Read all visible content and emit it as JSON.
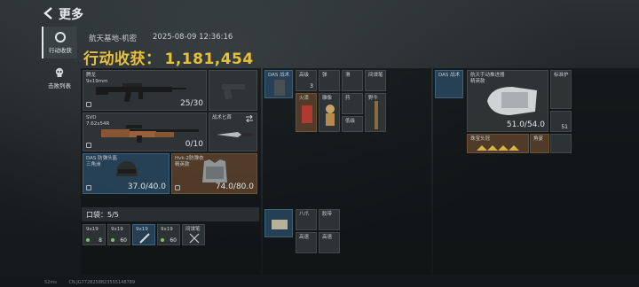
{
  "topbar": {
    "title": "更多"
  },
  "sidebar": {
    "tabs": [
      {
        "label": "行动收获",
        "icon": "target-icon"
      },
      {
        "label": "击败列表",
        "icon": "skull-icon"
      }
    ]
  },
  "info": {
    "location": "航天基地-机密",
    "timestamp": "2025-08-09 12:36:16",
    "value_label": "行动收获：",
    "value": "1,181,454"
  },
  "equipment": {
    "primary_weapon": {
      "name": "腾龙",
      "sub": "9x19mm",
      "count": "25/30"
    },
    "sidearm": {
      "name": ""
    },
    "sniper": {
      "name": "SVD",
      "sub": "7.62x54R",
      "count": "0/10"
    },
    "knife": {
      "name": "战术匕首"
    },
    "helmet": {
      "name": "DAS 防弹头盔",
      "sub": "三角洲",
      "count": "37.0/40.0"
    },
    "armor": {
      "name": "Hvk-2防弹衣",
      "sub": "精英款",
      "count": "74.0/80.0"
    }
  },
  "pockets": {
    "label": "口袋：",
    "value": "5/5",
    "items": [
      {
        "name": "9x19",
        "qty": "8"
      },
      {
        "name": "9x19",
        "qty": "60"
      },
      {
        "name": "9x19",
        "qty": ""
      },
      {
        "name": "9x19",
        "qty": "60"
      },
      {
        "name": "间谍笔",
        "qty": ""
      }
    ]
  },
  "rig": {
    "items": [
      {
        "name": "DAS 战术",
        "qty": ""
      },
      {
        "name": "高级",
        "qty": "3"
      },
      {
        "name": "弹",
        "qty": ""
      },
      {
        "name": "滑",
        "qty": ""
      },
      {
        "name": "间谍笔",
        "qty": ""
      },
      {
        "name": "火漆",
        "qty": ""
      },
      {
        "name": "雕像",
        "qty": ""
      },
      {
        "name": "药",
        "qty": ""
      },
      {
        "name": "",
        "qty": ""
      },
      {
        "name": "低级",
        "qty": ""
      },
      {
        "name": "野牛",
        "qty": ""
      },
      {
        "name": "",
        "qty": ""
      }
    ],
    "lower_items": [
      {
        "name": "",
        "qty": ""
      },
      {
        "name": "八爪",
        "qty": ""
      },
      {
        "name": "胶带",
        "qty": ""
      },
      {
        "name": "高速",
        "qty": ""
      },
      {
        "name": "高速",
        "qty": ""
      }
    ]
  },
  "backpack": {
    "items": [
      {
        "name": "DAS 战术",
        "qty": ""
      },
      {
        "name": "航天手动推进器",
        "sub": "精英款",
        "qty": ""
      },
      {
        "name": "标准护",
        "qty": ""
      },
      {
        "name": "",
        "qty": ""
      },
      {
        "name": "",
        "qty": ""
      },
      {
        "name": "珠宝头冠",
        "qty": ""
      },
      {
        "name": "角宴",
        "qty": ""
      },
      {
        "name": "",
        "qty": ""
      }
    ],
    "durability": "51.0/54.0",
    "small_count": "51"
  },
  "footer": {
    "ping": "52ms",
    "uid": "CN.JG7728258823555148789"
  },
  "colors": {
    "accent_gold": "#e9c03a",
    "blue_tier": "#294860",
    "brown_tier": "#5c422c"
  }
}
